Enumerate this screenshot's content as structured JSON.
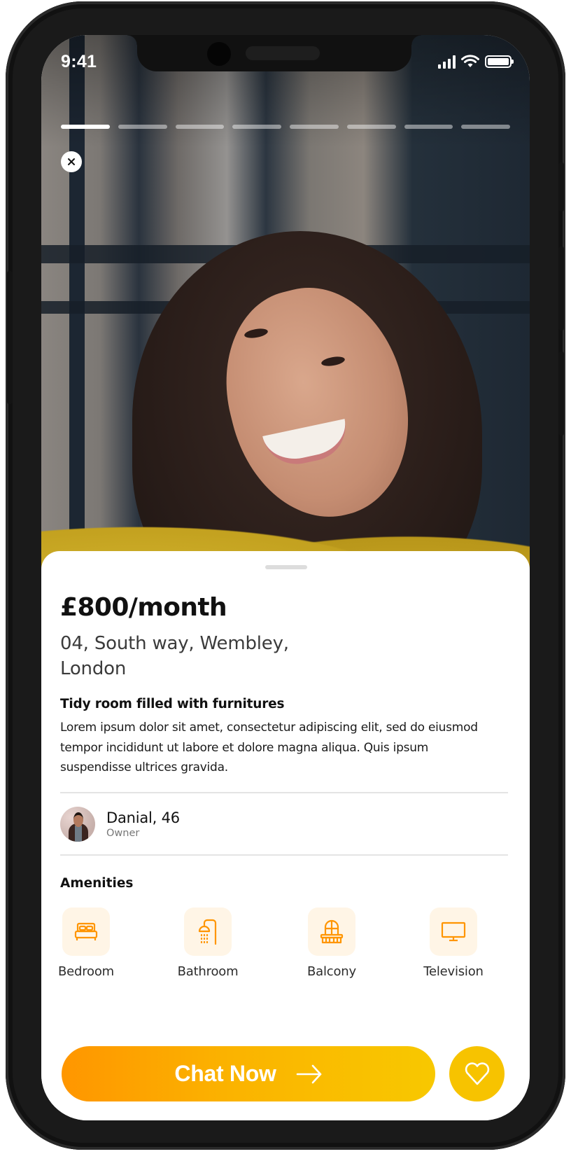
{
  "status_bar": {
    "time": "9:41",
    "icons": [
      "cellular-signal-icon",
      "wifi-icon",
      "battery-icon"
    ]
  },
  "story": {
    "segments": 8,
    "active_segment": 1,
    "close_icon": "close-icon"
  },
  "listing": {
    "price": "£800/month",
    "address": "04, South way, Wembley, London",
    "description_title": "Tidy room filled with furnitures",
    "description": "Lorem ipsum dolor sit amet, consectetur adipiscing elit, sed do eiusmod tempor incididunt ut labore et dolore magna aliqua. Quis ipsum suspendisse ultrices gravida."
  },
  "owner": {
    "name": "Danial, 46",
    "role": "Owner"
  },
  "amenities": {
    "title": "Amenities",
    "items": [
      {
        "label": "Bedroom",
        "icon": "bed-icon"
      },
      {
        "label": "Bathroom",
        "icon": "shower-icon"
      },
      {
        "label": "Balcony",
        "icon": "balcony-icon"
      },
      {
        "label": "Television",
        "icon": "television-icon"
      }
    ]
  },
  "actions": {
    "chat_label": "Chat Now",
    "chat_icon": "arrow-right-icon",
    "favorite_icon": "heart-icon"
  },
  "colors": {
    "accent_orange": "#ff9600",
    "accent_yellow": "#f8c800",
    "icon_orange": "#ff9500",
    "tile_bg": "#fff5e6"
  }
}
